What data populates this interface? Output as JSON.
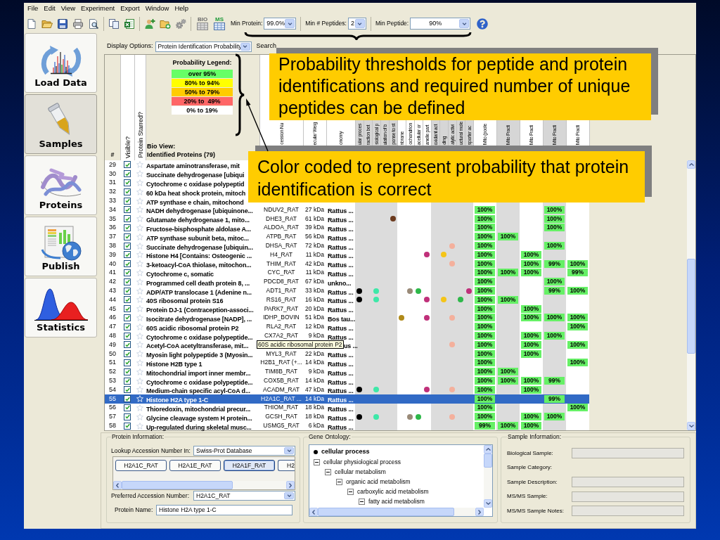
{
  "menu": [
    "File",
    "Edit",
    "View",
    "Experiment",
    "Export",
    "Window",
    "Help"
  ],
  "toolbar": {
    "icon_labels": [
      "BIO",
      "MS"
    ],
    "filters": [
      {
        "label": "Min Protein:",
        "value": "99.0%"
      },
      {
        "label": "Min # Peptides:",
        "value": "2"
      },
      {
        "label": "Min Peptide:",
        "value": "90%"
      }
    ]
  },
  "sidebar": {
    "items": [
      {
        "label": "Load Data",
        "selected": false
      },
      {
        "label": "Samples",
        "selected": true
      },
      {
        "label": "Proteins",
        "selected": false
      },
      {
        "label": "Publish",
        "selected": false
      },
      {
        "label": "Statistics",
        "selected": false
      }
    ]
  },
  "display_options": {
    "label": "Display Options:",
    "value": "Protein Identification Probability",
    "search_label": "Search"
  },
  "legend": {
    "title": "Probability Legend:",
    "entries": [
      {
        "label": "over 95%",
        "color": "#66ff66"
      },
      {
        "label": "80% to 94%",
        "color": "#ffff00"
      },
      {
        "label": "50% to 79%",
        "color": "#ffcc00"
      },
      {
        "label": "20% to  49%",
        "color": "#ff6666"
      },
      {
        "label": "0% to 19%",
        "color": "#ffffff"
      }
    ]
  },
  "table": {
    "header": {
      "number": "#",
      "visible": "Visible?",
      "starred": "Protein Starred?",
      "bio_view": "Bio View:",
      "title": "Identified Proteins (79)"
    },
    "info_columns": [
      "cession Nu",
      "ecular Weig",
      "onomy"
    ],
    "go_columns": [
      {
        "header": "ular proces",
        "shaded": true
      },
      {
        "header": "raction bet",
        "shaded": true
      },
      {
        "header": "siological p",
        "shaded": true
      },
      {
        "header": "ulation of b",
        "shaded": true
      },
      {
        "header": "ponse to st",
        "shaded": true
      },
      {
        "header": "nbrane",
        "shaded": false
      },
      {
        "header": "ochondrion",
        "shaded": false
      },
      {
        "header": "acellular or",
        "shaded": false
      },
      {
        "header": "anelle part",
        "shaded": false
      },
      {
        "header": "oxidant act",
        "shaded": true
      },
      {
        "header": "ding",
        "shaded": true
      },
      {
        "header": "alytic activi",
        "shaded": true
      },
      {
        "header": "uctural mole",
        "shaded": true
      },
      {
        "header": "sporter ac",
        "shaded": true
      }
    ],
    "sample_columns": [
      {
        "header": "Mito (poole",
        "shaded": false
      },
      {
        "header": "Mito Fracti",
        "shaded": true
      },
      {
        "header": "Mito Fracti",
        "shaded": false
      },
      {
        "header": "Mito Fracti",
        "shaded": true
      },
      {
        "header": "Mito Fracti",
        "shaded": false
      }
    ],
    "rows": [
      {
        "number": "29",
        "visible": true,
        "starred": false,
        "selected": false,
        "name": "Aspartate aminotransferase, mit"
      },
      {
        "number": "30",
        "visible": true,
        "starred": false,
        "selected": false,
        "name": "Succinate dehydrogenase [ubiqui"
      },
      {
        "number": "31",
        "visible": true,
        "starred": false,
        "selected": false,
        "name": "Cytochrome c oxidase polypeptid"
      },
      {
        "number": "32",
        "visible": true,
        "starred": false,
        "selected": false,
        "name": "60 kDa heat shock protein, mitoch"
      },
      {
        "number": "33",
        "visible": true,
        "starred": false,
        "selected": false,
        "name": "ATP synthase e chain, mitochond"
      },
      {
        "number": "34",
        "visible": true,
        "starred": false,
        "selected": false,
        "name": "NADH dehydrogenase [ubiquinone...",
        "accession": "NDUV2_RAT",
        "weight": "27 kDa",
        "organism": "Rattus ...",
        "samples": [
          {
            "kind": "badge",
            "text": "100%"
          },
          {
            "kind": "empty"
          },
          {
            "kind": "empty"
          },
          {
            "kind": "badge",
            "text": "100%"
          },
          {
            "kind": "empty"
          }
        ]
      },
      {
        "number": "35",
        "visible": true,
        "starred": false,
        "selected": false,
        "name": "Glutamate dehydrogenase 1, mito...",
        "accession": "DHE3_RAT",
        "weight": "61 kDa",
        "organism": "Rattus ...",
        "go": [
          {
            "kind": "empty"
          },
          {
            "kind": "empty"
          },
          {
            "kind": "empty"
          },
          {
            "kind": "empty"
          },
          {
            "kind": "dot",
            "color": "#6b3a1e"
          },
          {
            "kind": "empty"
          },
          {
            "kind": "empty"
          },
          {
            "kind": "empty"
          },
          {
            "kind": "empty"
          },
          {
            "kind": "empty"
          },
          {
            "kind": "empty"
          },
          {
            "kind": "empty"
          },
          {
            "kind": "empty"
          },
          {
            "kind": "empty"
          }
        ],
        "samples": [
          {
            "kind": "badge",
            "text": "100%"
          },
          {
            "kind": "empty"
          },
          {
            "kind": "empty"
          },
          {
            "kind": "badge",
            "text": "100%"
          },
          {
            "kind": "empty"
          }
        ]
      },
      {
        "number": "36",
        "visible": true,
        "starred": false,
        "selected": false,
        "name": "Fructose-bisphosphate aldolase A...",
        "accession": "ALDOA_RAT",
        "weight": "39 kDa",
        "organism": "Rattus ...",
        "samples": [
          {
            "kind": "badge",
            "text": "100%"
          },
          {
            "kind": "empty"
          },
          {
            "kind": "empty"
          },
          {
            "kind": "badge",
            "text": "100%"
          },
          {
            "kind": "empty"
          }
        ]
      },
      {
        "number": "37",
        "visible": true,
        "starred": false,
        "selected": false,
        "name": "ATP synthase subunit beta, mitoc...",
        "accession": "ATPB_RAT",
        "weight": "56 kDa",
        "organism": "Rattus ...",
        "samples": [
          {
            "kind": "badge",
            "text": "100%"
          },
          {
            "kind": "badge",
            "text": "100%"
          },
          {
            "kind": "empty"
          },
          {
            "kind": "empty"
          },
          {
            "kind": "empty"
          }
        ]
      },
      {
        "number": "38",
        "visible": true,
        "starred": false,
        "selected": false,
        "name": "Succinate dehydrogenase [ubiquin...",
        "accession": "DHSA_RAT",
        "weight": "72 kDa",
        "organism": "Rattus ...",
        "go": [
          {
            "kind": "empty"
          },
          {
            "kind": "empty"
          },
          {
            "kind": "empty"
          },
          {
            "kind": "empty"
          },
          {
            "kind": "empty"
          },
          {
            "kind": "empty"
          },
          {
            "kind": "empty"
          },
          {
            "kind": "empty"
          },
          {
            "kind": "empty"
          },
          {
            "kind": "empty"
          },
          {
            "kind": "empty"
          },
          {
            "kind": "dot",
            "color": "#f4b09c"
          },
          {
            "kind": "empty"
          },
          {
            "kind": "empty"
          }
        ],
        "samples": [
          {
            "kind": "badge",
            "text": "100%"
          },
          {
            "kind": "empty"
          },
          {
            "kind": "empty"
          },
          {
            "kind": "badge",
            "text": "100%"
          },
          {
            "kind": "empty"
          }
        ]
      },
      {
        "number": "39",
        "visible": true,
        "starred": false,
        "selected": false,
        "name": "Histone H4 [Contains: Osteogenic ...",
        "accession": "H4_RAT",
        "weight": "11 kDa",
        "organism": "Rattus ...",
        "go": [
          {
            "kind": "empty"
          },
          {
            "kind": "empty"
          },
          {
            "kind": "empty"
          },
          {
            "kind": "empty"
          },
          {
            "kind": "empty"
          },
          {
            "kind": "empty"
          },
          {
            "kind": "empty"
          },
          {
            "kind": "empty"
          },
          {
            "kind": "dot",
            "color": "#c0307a"
          },
          {
            "kind": "empty"
          },
          {
            "kind": "dot",
            "color": "#f5c518"
          },
          {
            "kind": "empty"
          },
          {
            "kind": "empty"
          },
          {
            "kind": "empty"
          }
        ],
        "samples": [
          {
            "kind": "badge",
            "text": "100%"
          },
          {
            "kind": "empty"
          },
          {
            "kind": "badge",
            "text": "100%"
          },
          {
            "kind": "empty"
          },
          {
            "kind": "empty"
          }
        ]
      },
      {
        "number": "40",
        "visible": true,
        "starred": false,
        "selected": false,
        "name": "3-ketoacyl-CoA thiolase, mitochon...",
        "accession": "THIM_RAT",
        "weight": "42 kDa",
        "organism": "Rattus ...",
        "go": [
          {
            "kind": "empty"
          },
          {
            "kind": "empty"
          },
          {
            "kind": "empty"
          },
          {
            "kind": "empty"
          },
          {
            "kind": "empty"
          },
          {
            "kind": "empty"
          },
          {
            "kind": "empty"
          },
          {
            "kind": "empty"
          },
          {
            "kind": "empty"
          },
          {
            "kind": "empty"
          },
          {
            "kind": "empty"
          },
          {
            "kind": "dot",
            "color": "#f4b09c"
          },
          {
            "kind": "empty"
          },
          {
            "kind": "empty"
          }
        ],
        "samples": [
          {
            "kind": "badge",
            "text": "100%"
          },
          {
            "kind": "empty"
          },
          {
            "kind": "badge",
            "text": "100%"
          },
          {
            "kind": "badge",
            "text": "99%"
          },
          {
            "kind": "badge",
            "text": "100%"
          }
        ]
      },
      {
        "number": "41",
        "visible": true,
        "starred": false,
        "selected": false,
        "name": "Cytochrome c, somatic",
        "accession": "CYC_RAT",
        "weight": "11 kDa",
        "organism": "Rattus ...",
        "samples": [
          {
            "kind": "badge",
            "text": "100%"
          },
          {
            "kind": "badge",
            "text": "100%"
          },
          {
            "kind": "badge",
            "text": "100%"
          },
          {
            "kind": "empty"
          },
          {
            "kind": "badge",
            "text": "99%"
          }
        ]
      },
      {
        "number": "42",
        "visible": true,
        "starred": false,
        "selected": false,
        "name": "Programmed cell death protein 8, ...",
        "accession": "PDCD8_RAT",
        "weight": "67 kDa",
        "organism": "unkno...",
        "samples": [
          {
            "kind": "badge",
            "text": "100%"
          },
          {
            "kind": "empty"
          },
          {
            "kind": "empty"
          },
          {
            "kind": "badge",
            "text": "100%"
          },
          {
            "kind": "empty"
          }
        ]
      },
      {
        "number": "43",
        "visible": true,
        "starred": false,
        "selected": false,
        "name": "ADP/ATP translocase 1 (Adenine n...",
        "accession": "ADT1_RAT",
        "weight": "33 kDa",
        "organism": "Rattus ...",
        "go": [
          {
            "kind": "dot",
            "color": "#000000"
          },
          {
            "kind": "empty"
          },
          {
            "kind": "dot",
            "color": "#3ee8a8"
          },
          {
            "kind": "empty"
          },
          {
            "kind": "empty"
          },
          {
            "kind": "empty"
          },
          {
            "kind": "dot",
            "color": "#9a8a78"
          },
          {
            "kind": "dot",
            "color": "#2eb84a"
          },
          {
            "kind": "empty"
          },
          {
            "kind": "empty"
          },
          {
            "kind": "empty"
          },
          {
            "kind": "empty"
          },
          {
            "kind": "empty"
          },
          {
            "kind": "dot",
            "color": "#c0307a"
          }
        ],
        "samples": [
          {
            "kind": "badge",
            "text": "100%"
          },
          {
            "kind": "empty"
          },
          {
            "kind": "empty"
          },
          {
            "kind": "badge",
            "text": "99%"
          },
          {
            "kind": "badge",
            "text": "100%"
          }
        ]
      },
      {
        "number": "44",
        "visible": true,
        "starred": false,
        "selected": false,
        "name": "40S ribosomal protein S16",
        "accession": "RS16_RAT",
        "weight": "16 kDa",
        "organism": "Rattus ...",
        "go": [
          {
            "kind": "dot",
            "color": "#000000"
          },
          {
            "kind": "empty"
          },
          {
            "kind": "dot",
            "color": "#3ee8a8"
          },
          {
            "kind": "empty"
          },
          {
            "kind": "empty"
          },
          {
            "kind": "empty"
          },
          {
            "kind": "empty"
          },
          {
            "kind": "empty"
          },
          {
            "kind": "dot",
            "color": "#c0307a"
          },
          {
            "kind": "empty"
          },
          {
            "kind": "dot",
            "color": "#f5c518"
          },
          {
            "kind": "empty"
          },
          {
            "kind": "dot",
            "color": "#2eb84a"
          },
          {
            "kind": "empty"
          }
        ],
        "samples": [
          {
            "kind": "badge",
            "text": "100%"
          },
          {
            "kind": "badge",
            "text": "100%"
          },
          {
            "kind": "empty"
          },
          {
            "kind": "empty"
          },
          {
            "kind": "empty"
          }
        ]
      },
      {
        "number": "45",
        "visible": true,
        "starred": false,
        "selected": false,
        "name": "Protein DJ-1 (Contraception-associ...",
        "accession": "PARK7_RAT",
        "weight": "20 kDa",
        "organism": "Rattus ...",
        "samples": [
          {
            "kind": "badge",
            "text": "100%"
          },
          {
            "kind": "empty"
          },
          {
            "kind": "badge",
            "text": "100%"
          },
          {
            "kind": "empty"
          },
          {
            "kind": "empty"
          }
        ]
      },
      {
        "number": "46",
        "visible": true,
        "starred": false,
        "selected": false,
        "name": "Isocitrate dehydrogenase [NADP], ...",
        "accession": "IDHP_BOVIN",
        "weight": "51 kDa",
        "organism": "Bos tau...",
        "go": [
          {
            "kind": "empty"
          },
          {
            "kind": "empty"
          },
          {
            "kind": "empty"
          },
          {
            "kind": "empty"
          },
          {
            "kind": "empty"
          },
          {
            "kind": "dot",
            "color": "#b08a1a"
          },
          {
            "kind": "empty"
          },
          {
            "kind": "empty"
          },
          {
            "kind": "dot",
            "color": "#c0307a"
          },
          {
            "kind": "empty"
          },
          {
            "kind": "empty"
          },
          {
            "kind": "dot",
            "color": "#f4b09c"
          },
          {
            "kind": "empty"
          },
          {
            "kind": "empty"
          }
        ],
        "samples": [
          {
            "kind": "badge",
            "text": "100%"
          },
          {
            "kind": "empty"
          },
          {
            "kind": "badge",
            "text": "100%"
          },
          {
            "kind": "badge",
            "text": "100%"
          },
          {
            "kind": "badge",
            "text": "100%"
          }
        ]
      },
      {
        "number": "47",
        "visible": true,
        "starred": false,
        "selected": false,
        "name": "60S acidic ribosomal protein P2",
        "accession": "RLA2_RAT",
        "weight": "12 kDa",
        "organism": "Rattus ...",
        "samples": [
          {
            "kind": "badge",
            "text": "100%"
          },
          {
            "kind": "empty"
          },
          {
            "kind": "empty"
          },
          {
            "kind": "empty"
          },
          {
            "kind": "badge",
            "text": "100%"
          }
        ]
      },
      {
        "number": "48",
        "visible": true,
        "starred": false,
        "selected": false,
        "name": "Cytochrome c oxidase polypeptide...",
        "accession": "CX7A2_RAT",
        "weight": "9 kDa",
        "organism": "Rattus ...",
        "samples": [
          {
            "kind": "badge",
            "text": "100%"
          },
          {
            "kind": "empty"
          },
          {
            "kind": "badge",
            "text": "100%"
          },
          {
            "kind": "badge",
            "text": "100%"
          },
          {
            "kind": "empty"
          }
        ]
      },
      {
        "number": "49",
        "visible": true,
        "starred": false,
        "selected": false,
        "name": "Acetyl-CoA acetyltransferase, mit...",
        "tooltip": "60S acidic ribosomal protein P2",
        "organism": "us ...",
        "go": [
          {
            "kind": "empty"
          },
          {
            "kind": "empty"
          },
          {
            "kind": "empty"
          },
          {
            "kind": "empty"
          },
          {
            "kind": "empty"
          },
          {
            "kind": "empty"
          },
          {
            "kind": "empty"
          },
          {
            "kind": "empty"
          },
          {
            "kind": "empty"
          },
          {
            "kind": "empty"
          },
          {
            "kind": "empty"
          },
          {
            "kind": "dot",
            "color": "#f4b09c"
          },
          {
            "kind": "empty"
          },
          {
            "kind": "empty"
          }
        ],
        "samples": [
          {
            "kind": "badge",
            "text": "100%"
          },
          {
            "kind": "empty"
          },
          {
            "kind": "badge",
            "text": "100%"
          },
          {
            "kind": "empty"
          },
          {
            "kind": "badge",
            "text": "100%"
          }
        ]
      },
      {
        "number": "50",
        "visible": true,
        "starred": false,
        "selected": false,
        "name": "Myosin light polypeptide 3 (Myosin...",
        "accession": "MYL3_RAT",
        "weight": "22 kDa",
        "organism": "Rattus ...",
        "samples": [
          {
            "kind": "badge",
            "text": "100%"
          },
          {
            "kind": "empty"
          },
          {
            "kind": "badge",
            "text": "100%"
          },
          {
            "kind": "empty"
          },
          {
            "kind": "empty"
          }
        ]
      },
      {
        "number": "51",
        "visible": true,
        "starred": false,
        "selected": false,
        "name": "Histone H2B type 1",
        "accession": "H2B1_RAT (+...",
        "weight": "14 kDa",
        "organism": "Rattus ...",
        "samples": [
          {
            "kind": "badge",
            "text": "100%"
          },
          {
            "kind": "empty"
          },
          {
            "kind": "empty"
          },
          {
            "kind": "empty"
          },
          {
            "kind": "badge",
            "text": "100%"
          }
        ]
      },
      {
        "number": "52",
        "visible": true,
        "starred": false,
        "selected": false,
        "name": "Mitochondrial import inner membr...",
        "accession": "TIM8B_RAT",
        "weight": "9 kDa",
        "organism": "Rattus ...",
        "samples": [
          {
            "kind": "badge",
            "text": "100%"
          },
          {
            "kind": "badge",
            "text": "100%"
          },
          {
            "kind": "empty"
          },
          {
            "kind": "empty"
          },
          {
            "kind": "empty"
          }
        ]
      },
      {
        "number": "53",
        "visible": true,
        "starred": false,
        "selected": false,
        "name": "Cytochrome c oxidase polypeptide...",
        "accession": "COX5B_RAT",
        "weight": "14 kDa",
        "organism": "Rattus ...",
        "samples": [
          {
            "kind": "badge",
            "text": "100%"
          },
          {
            "kind": "badge",
            "text": "100%"
          },
          {
            "kind": "badge",
            "text": "100%"
          },
          {
            "kind": "badge",
            "text": "99%"
          },
          {
            "kind": "empty"
          }
        ]
      },
      {
        "number": "54",
        "visible": true,
        "starred": false,
        "selected": false,
        "name": "Medium-chain specific acyl-CoA d...",
        "accession": "ACADM_RAT",
        "weight": "47 kDa",
        "organism": "Rattus ...",
        "go": [
          {
            "kind": "dot",
            "color": "#000000"
          },
          {
            "kind": "empty"
          },
          {
            "kind": "dot",
            "color": "#3ee8a8"
          },
          {
            "kind": "empty"
          },
          {
            "kind": "empty"
          },
          {
            "kind": "empty"
          },
          {
            "kind": "empty"
          },
          {
            "kind": "empty"
          },
          {
            "kind": "dot",
            "color": "#c0307a"
          },
          {
            "kind": "empty"
          },
          {
            "kind": "empty"
          },
          {
            "kind": "dot",
            "color": "#f4b09c"
          },
          {
            "kind": "empty"
          },
          {
            "kind": "empty"
          }
        ],
        "samples": [
          {
            "kind": "badge",
            "text": "100%"
          },
          {
            "kind": "empty"
          },
          {
            "kind": "badge",
            "text": "100%"
          },
          {
            "kind": "empty"
          },
          {
            "kind": "empty"
          }
        ]
      },
      {
        "number": "55",
        "visible": true,
        "starred": false,
        "selected": true,
        "name": "Histone H2A type 1-C",
        "accession": "H2A1C_RAT ...",
        "weight": "14 kDa",
        "organism": "Rattus ...",
        "samples": [
          {
            "kind": "badge",
            "text": "100%"
          },
          {
            "kind": "empty"
          },
          {
            "kind": "empty"
          },
          {
            "kind": "badge",
            "text": "99%"
          },
          {
            "kind": "empty"
          }
        ]
      },
      {
        "number": "56",
        "visible": true,
        "starred": false,
        "selected": false,
        "name": "Thioredoxin, mitochondrial precur...",
        "accession": "THIOM_RAT",
        "weight": "18 kDa",
        "organism": "Rattus ...",
        "samples": [
          {
            "kind": "badge",
            "text": "100%"
          },
          {
            "kind": "empty"
          },
          {
            "kind": "empty"
          },
          {
            "kind": "empty"
          },
          {
            "kind": "badge",
            "text": "100%"
          }
        ]
      },
      {
        "number": "57",
        "visible": true,
        "starred": false,
        "selected": false,
        "name": "Glycine cleavage system H protein...",
        "accession": "GCSH_RAT",
        "weight": "18 kDa",
        "organism": "Rattus ...",
        "go": [
          {
            "kind": "dot",
            "color": "#000000"
          },
          {
            "kind": "empty"
          },
          {
            "kind": "dot",
            "color": "#3ee8a8"
          },
          {
            "kind": "empty"
          },
          {
            "kind": "empty"
          },
          {
            "kind": "empty"
          },
          {
            "kind": "dot",
            "color": "#9a8a78"
          },
          {
            "kind": "dot",
            "color": "#2eb84a"
          },
          {
            "kind": "empty"
          },
          {
            "kind": "empty"
          },
          {
            "kind": "empty"
          },
          {
            "kind": "dot",
            "color": "#f4b09c"
          },
          {
            "kind": "empty"
          },
          {
            "kind": "empty"
          }
        ],
        "samples": [
          {
            "kind": "badge",
            "text": "100%"
          },
          {
            "kind": "empty"
          },
          {
            "kind": "badge",
            "text": "100%"
          },
          {
            "kind": "badge",
            "text": "100%"
          },
          {
            "kind": "empty"
          }
        ]
      },
      {
        "number": "58",
        "visible": true,
        "starred": false,
        "selected": false,
        "name": "Up-regulated during skeletal musc...",
        "accession": "USMG5_RAT",
        "weight": "6 kDa",
        "organism": "Rattus ...",
        "samples": [
          {
            "kind": "badge",
            "text": "99%"
          },
          {
            "kind": "badge",
            "text": "100%"
          },
          {
            "kind": "badge",
            "text": "100%"
          },
          {
            "kind": "empty"
          },
          {
            "kind": "empty"
          }
        ]
      }
    ]
  },
  "protein_information": {
    "title": "Protein Information:",
    "lookup": {
      "label": "Lookup Accession Number In:",
      "value": "Swiss-Prot Database"
    },
    "accessions": [
      {
        "label": "H2A1C_RAT",
        "selected": false
      },
      {
        "label": "H2A1E_RAT",
        "selected": false
      },
      {
        "label": "H2A1F_RAT",
        "selected": true
      },
      {
        "label": "H2",
        "selected": false
      }
    ],
    "preferred": {
      "label": "Preferred Accession Number:",
      "value": "H2A1C_RAT"
    },
    "protein_name": {
      "label": "Protein Name:",
      "value": "Histone H2A type 1-C"
    }
  },
  "gene_ontology": {
    "title": "Gene Ontology:",
    "tree": [
      {
        "label": "cellular process",
        "kind": "bullet"
      },
      {
        "label": "cellular physiological process",
        "kind": "node",
        "expanded": true,
        "children": [
          {
            "label": "cellular metabolism",
            "kind": "node",
            "expanded": true,
            "children": [
              {
                "label": "organic acid metabolism",
                "kind": "node",
                "expanded": true,
                "children": [
                  {
                    "label": "carboxylic acid metabolism",
                    "kind": "node",
                    "expanded": true,
                    "children": [
                      {
                        "label": "fatty acid metabolism",
                        "kind": "node",
                        "expanded": true
                      }
                    ]
                  }
                ]
              }
            ]
          }
        ]
      }
    ]
  },
  "sample_information": {
    "title": "Sample Information:",
    "fields": [
      {
        "label": "Biological Sample:",
        "kind": "field",
        "disabled": true
      },
      {
        "label": "Sample Category:",
        "kind": "label"
      },
      {
        "label": "Sample Description:",
        "kind": "field",
        "disabled": true
      },
      {
        "label": "MS/MS Sample:",
        "kind": "field",
        "disabled": true
      },
      {
        "label": "MS/MS Sample Notes:",
        "kind": "field",
        "disabled": true
      }
    ]
  },
  "callouts": [
    {
      "text": "Probability thresholds for peptide and protein identifications and required number of unique peptides can be defined"
    },
    {
      "text": "Color coded to represent probability that protein identification is correct"
    }
  ]
}
